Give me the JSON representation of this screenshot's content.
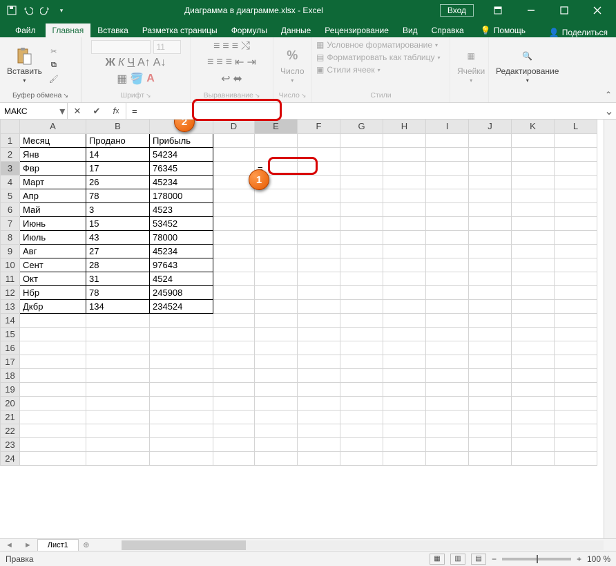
{
  "title": "Диаграмма в диаграмме.xlsx - Excel",
  "login": "Вход",
  "tabs": {
    "file": "Файл",
    "home": "Главная",
    "insert": "Вставка",
    "layout": "Разметка страницы",
    "formulas": "Формулы",
    "data": "Данные",
    "review": "Рецензирование",
    "view": "Вид",
    "help": "Справка",
    "tell": "Помощь",
    "share": "Поделиться"
  },
  "ribbon": {
    "clipboard": {
      "label": "Буфер обмена",
      "paste": "Вставить"
    },
    "font": {
      "label": "Шрифт",
      "name": "",
      "size": "11"
    },
    "alignment": {
      "label": "Выравнивание"
    },
    "number": {
      "label": "Число",
      "title": "Число"
    },
    "styles": {
      "label": "Стили",
      "cond": "Условное форматирование",
      "table": "Форматировать как таблицу",
      "cell": "Стили ячеек"
    },
    "cells": {
      "label": "Ячейки"
    },
    "editing": {
      "label": "Редактирование"
    }
  },
  "namebox": "МАКС",
  "formula": "=",
  "columns": [
    "A",
    "B",
    "C",
    "D",
    "E",
    "F",
    "G",
    "H",
    "I",
    "J",
    "K",
    "L"
  ],
  "headers": {
    "A": "Месяц",
    "B": "Продано",
    "C": "Прибыль"
  },
  "rows": [
    {
      "A": "Янв",
      "B": 14,
      "C": 54234
    },
    {
      "A": "Фвр",
      "B": 17,
      "C": 76345
    },
    {
      "A": "Март",
      "B": 26,
      "C": 45234
    },
    {
      "A": "Апр",
      "B": 78,
      "C": 178000
    },
    {
      "A": "Май",
      "B": 3,
      "C": 4523
    },
    {
      "A": "Июнь",
      "B": 15,
      "C": 53452
    },
    {
      "A": "Июль",
      "B": 43,
      "C": 78000
    },
    {
      "A": "Авг",
      "B": 27,
      "C": 45234
    },
    {
      "A": "Сент",
      "B": 28,
      "C": 97643
    },
    {
      "A": "Окт",
      "B": 31,
      "C": 4524
    },
    {
      "A": "Нбр",
      "B": 78,
      "C": 245908
    },
    {
      "A": "Дкбр",
      "B": 134,
      "C": 234524
    }
  ],
  "active_cell": "E3",
  "active_value": "=",
  "sheet_tab": "Лист1",
  "status": "Правка",
  "zoom": "100 %",
  "callouts": {
    "1": "1",
    "2": "2"
  }
}
